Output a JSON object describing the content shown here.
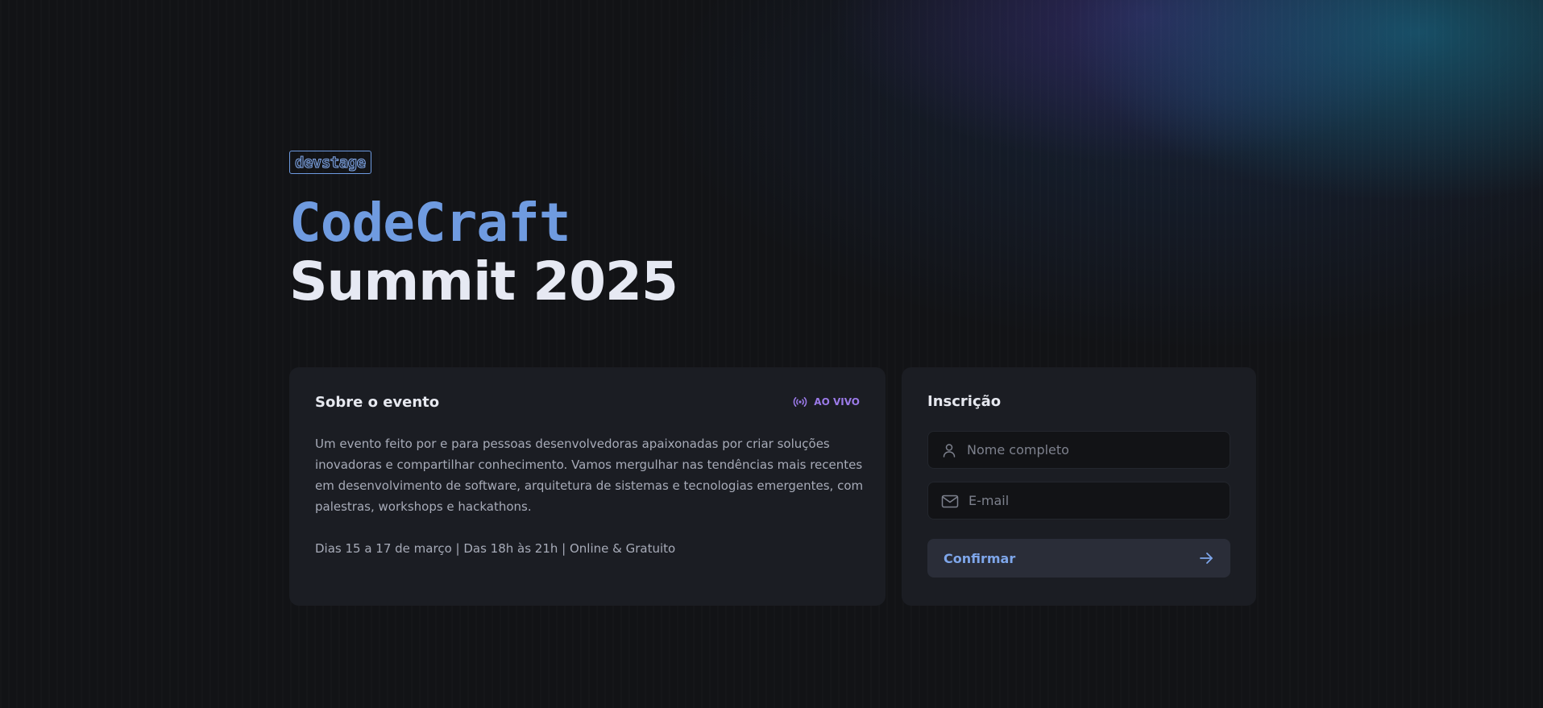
{
  "brand": {
    "logo_text": "devstage"
  },
  "hero": {
    "title_line1": "CodeCraft",
    "title_line2": "Summit 2025"
  },
  "about": {
    "title": "Sobre o evento",
    "live_badge": "AO VIVO",
    "live_icon": "broadcast-icon",
    "description": "Um evento feito por e para pessoas desenvolvedoras apaixonadas por criar soluções inovadoras e compartilhar conhecimento. Vamos mergulhar nas tendências mais recentes em desenvolvimento de software, arquitetura de sistemas e tecnologias emergentes, com palestras, workshops e hackathons.",
    "info": "Dias 15 a 17 de março | Das 18h às 21h | Online & Gratuito"
  },
  "signup": {
    "title": "Inscrição",
    "name_placeholder": "Nome completo",
    "name_icon": "user-icon",
    "email_placeholder": "E-mail",
    "email_icon": "mail-icon",
    "submit_label": "Confirmar",
    "submit_icon": "arrow-right-icon"
  },
  "colors": {
    "background": "#121316",
    "card": "#1b1d23",
    "accent_blue": "#6f9be0",
    "accent_purple": "#9b7ae8",
    "title_white": "#e6e9f3"
  }
}
